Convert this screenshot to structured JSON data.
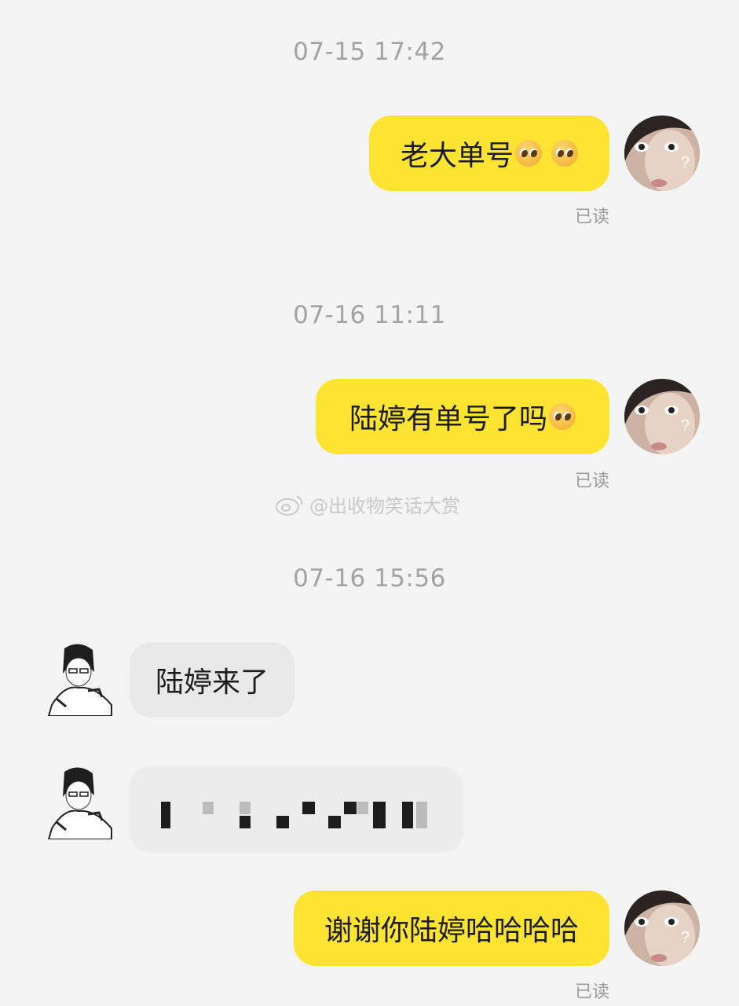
{
  "watermark": {
    "text": "@出收物笑话大赏",
    "icon": "weibo-icon"
  },
  "messages": [
    {
      "timestamp": "07-15 17:42",
      "direction": "out",
      "text": "老大单号",
      "emoji": [
        "pleading-face",
        "pleading-face"
      ],
      "status": "已读"
    },
    {
      "timestamp": "07-16 11:11",
      "direction": "out",
      "text": "陆婷有单号了吗",
      "emoji": [
        "face-holding-back-tears"
      ],
      "status": "已读"
    },
    {
      "timestamp": "07-16 15:56",
      "direction": "in",
      "text": "陆婷来了"
    },
    {
      "direction": "in",
      "text": "",
      "redacted": true
    },
    {
      "direction": "out",
      "text": "谢谢你陆婷哈哈哈哈",
      "status": "已读"
    }
  ],
  "colors": {
    "outgoing_bubble": "#fde332",
    "incoming_bubble": "#e9e9ea",
    "background": "#f4f4f4"
  }
}
